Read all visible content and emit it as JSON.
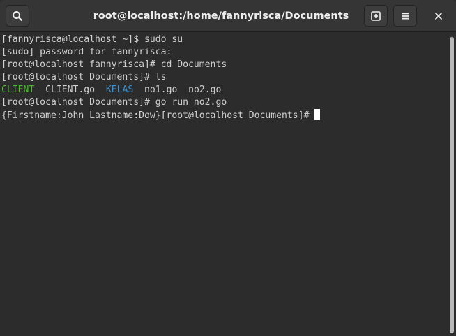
{
  "window": {
    "title": "root@localhost:/home/fannyrisca/Documents"
  },
  "headerbar": {
    "search_icon": "search-icon",
    "new_tab_icon": "new-tab-icon",
    "menu_icon": "hamburger-menu-icon",
    "close_icon": "close-icon",
    "close_glyph": "✕"
  },
  "terminal": {
    "lines": [
      "[fannyrisca@localhost ~]$ sudo su",
      "[sudo] password for fannyrisca:",
      "[root@localhost fannyrisca]# cd Documents",
      "[root@localhost Documents]# ls"
    ],
    "ls_output": {
      "item1": "CLIENT",
      "item2": "CLIENT.go",
      "item3": "KELAS",
      "item4": "no1.go",
      "item5": "no2.go"
    },
    "after_ls": "[root@localhost Documents]# go run no2.go",
    "last_line": "{Firstname:John Lastname:Dow}[root@localhost Documents]# "
  },
  "colors": {
    "executable": "#4bbf2f",
    "directory": "#3a8fd0",
    "foreground": "#d0d0d0",
    "background": "#2c2c2c"
  }
}
